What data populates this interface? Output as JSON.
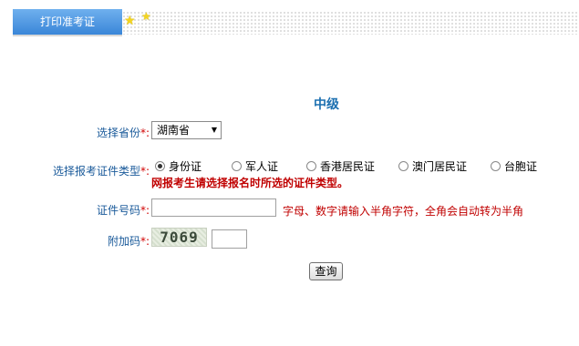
{
  "header": {
    "tab_label": "打印准考证"
  },
  "page_title": "中级",
  "form": {
    "province": {
      "label": "选择省份",
      "required_mark": "*:",
      "value": "湖南省"
    },
    "id_type": {
      "label": "选择报考证件类型",
      "required_mark": "*:",
      "options": [
        "身份证",
        "军人证",
        "香港居民证",
        "澳门居民证",
        "台胞证"
      ],
      "selected": "身份证",
      "note": "网报考生请选择报名时所选的证件类型。"
    },
    "id_number": {
      "label": "证件号码",
      "required_mark": "*:",
      "value": "",
      "hint": "字母、数字请输入半角字符，全角会自动转为半角"
    },
    "captcha": {
      "label": "附加码",
      "required_mark": "*:",
      "code": "7069",
      "value": ""
    },
    "submit_label": "查询"
  },
  "colors": {
    "label": "#1a5a9a",
    "required": "#d00000",
    "tab": "#3a86d8",
    "title": "#1b6fb0"
  }
}
